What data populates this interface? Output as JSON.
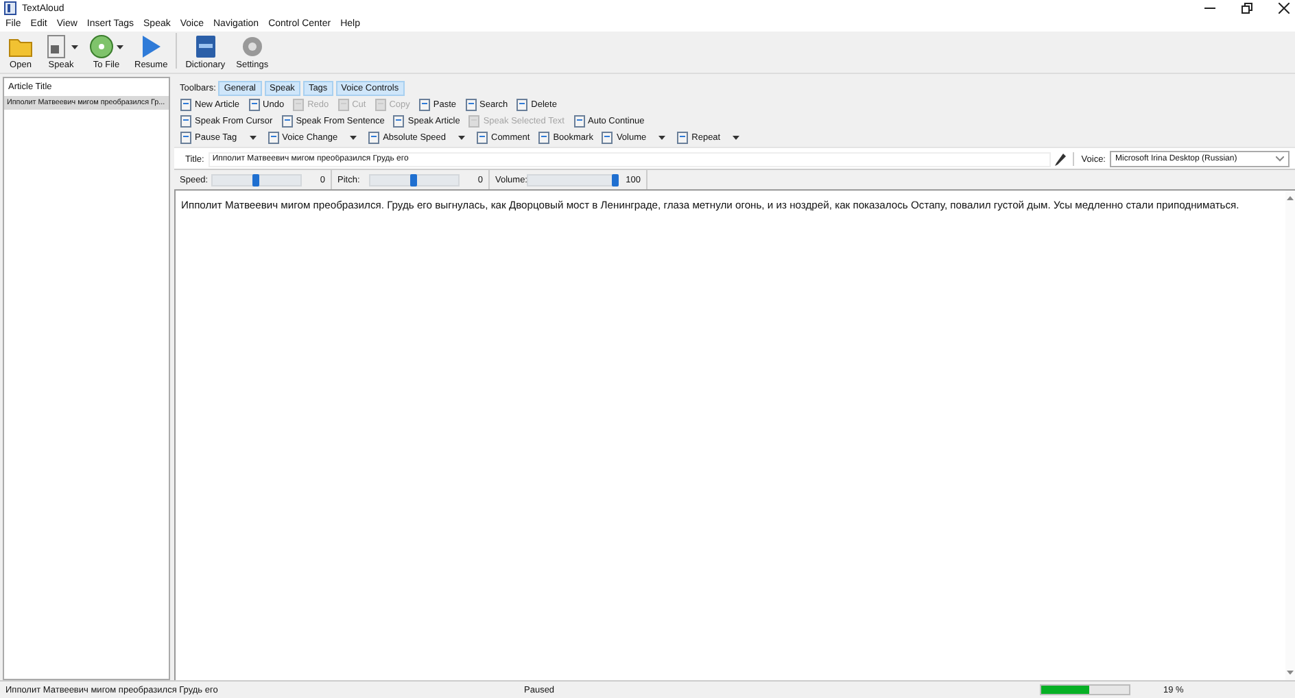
{
  "window": {
    "title": "TextAloud"
  },
  "menu": [
    "File",
    "Edit",
    "View",
    "Insert Tags",
    "Speak",
    "Voice",
    "Navigation",
    "Control Center",
    "Help"
  ],
  "main_toolbar_groups": [
    [
      {
        "label": "Open",
        "dropdown": false
      },
      {
        "label": "Speak",
        "dropdown": true
      },
      {
        "label": "To File",
        "dropdown": true
      },
      {
        "label": "Resume",
        "dropdown": false
      }
    ],
    [
      {
        "label": "Dictionary",
        "dropdown": false
      },
      {
        "label": "Settings",
        "dropdown": false
      }
    ]
  ],
  "article_list": {
    "header": "Article Title",
    "items": [
      {
        "title": "Ипполит Матвеевич мигом преобразился Гр...",
        "selected": true
      }
    ]
  },
  "toolbars": {
    "label": "Toolbars:",
    "tabs": [
      {
        "label": "General",
        "on": true
      },
      {
        "label": "Speak",
        "on": true
      },
      {
        "label": "Tags",
        "on": true
      },
      {
        "label": "Voice Controls",
        "on": true
      }
    ]
  },
  "toolbar_rows": [
    [
      {
        "label": "New Article",
        "disabled": false,
        "dropdown": false
      },
      {
        "label": "Undo",
        "disabled": false,
        "dropdown": false
      },
      {
        "label": "Redo",
        "disabled": true,
        "dropdown": false
      },
      {
        "label": "Cut",
        "disabled": true,
        "dropdown": false
      },
      {
        "label": "Copy",
        "disabled": true,
        "dropdown": false
      },
      {
        "label": "Paste",
        "disabled": false,
        "dropdown": false
      },
      {
        "label": "Search",
        "disabled": false,
        "dropdown": false
      },
      {
        "label": "Delete",
        "disabled": false,
        "dropdown": false
      }
    ],
    [
      {
        "label": "Speak From Cursor",
        "disabled": false,
        "dropdown": false
      },
      {
        "label": "Speak From Sentence",
        "disabled": false,
        "dropdown": false
      },
      {
        "label": "Speak Article",
        "disabled": false,
        "dropdown": false
      },
      {
        "label": "Speak Selected Text",
        "disabled": true,
        "dropdown": false
      },
      {
        "label": "Auto Continue",
        "disabled": false,
        "dropdown": false
      }
    ],
    [
      {
        "label": "Pause Tag",
        "disabled": false,
        "dropdown": true
      },
      {
        "label": "Voice Change",
        "disabled": false,
        "dropdown": true
      },
      {
        "label": "Absolute Speed",
        "disabled": false,
        "dropdown": true
      },
      {
        "label": "Comment",
        "disabled": false,
        "dropdown": false
      },
      {
        "label": "Bookmark",
        "disabled": false,
        "dropdown": false
      },
      {
        "label": "Volume",
        "disabled": false,
        "dropdown": true
      },
      {
        "label": "Repeat",
        "disabled": false,
        "dropdown": true
      }
    ]
  ],
  "title_field": {
    "label": "Title:",
    "value": "Ипполит Матвеевич мигом преобразился Грудь его"
  },
  "voice": {
    "label": "Voice:",
    "value": "Microsoft Irina Desktop (Russian)"
  },
  "sliders": [
    {
      "label": "Speed:",
      "level": 0.5,
      "reading": "0"
    },
    {
      "label": "Pitch:",
      "level": 0.5,
      "reading": "0"
    },
    {
      "label": "Volume:",
      "level": 1,
      "reading": "100"
    }
  ],
  "editor": {
    "text": "Ипполит Матвеевич мигом преобразился. Грудь его выгнулась, как Дворцовый мост в Ленинграде, глаза метнули огонь, и из ноздрей, как показалось Остапу, повалил густой дым. Усы медленно стали приподниматься."
  },
  "status_bar": {
    "article": "Ипполит Матвеевич мигом преобразился Грудь его",
    "state": "Paused",
    "progress": {
      "level": 0.55,
      "reading": "19 %"
    }
  }
}
